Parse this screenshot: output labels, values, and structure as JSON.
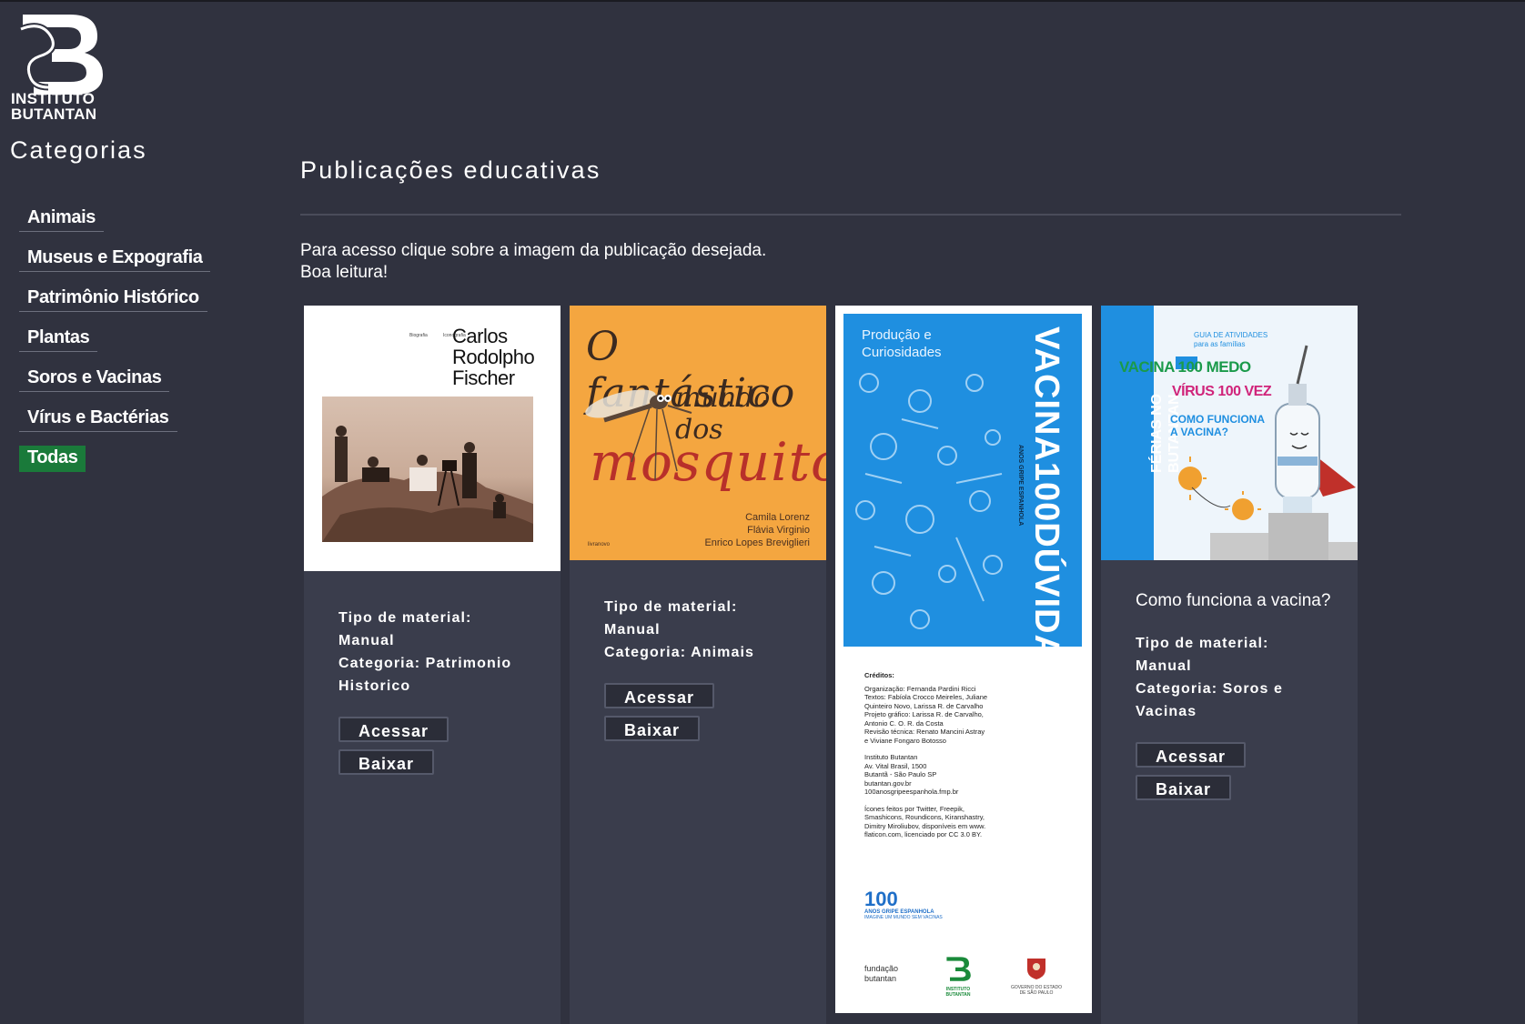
{
  "brand": {
    "line1": "INSTITUTO",
    "line2": "BUTANTAN"
  },
  "sidebar": {
    "title": "Categorias",
    "items": [
      {
        "label": "Animais",
        "active": false
      },
      {
        "label": "Museus e Expografia",
        "active": false
      },
      {
        "label": "Patrimônio Histórico",
        "active": false
      },
      {
        "label": "Plantas",
        "active": false
      },
      {
        "label": "Soros e Vacinas",
        "active": false
      },
      {
        "label": "Vírus e Bactérias",
        "active": false
      },
      {
        "label": "Todas",
        "active": true
      }
    ]
  },
  "main": {
    "title": "Publicações educativas",
    "intro_line1": "Para acesso clique sobre a imagem da publicação desejada.",
    "intro_line2": "Boa leitura!"
  },
  "cards": [
    {
      "cover": {
        "title_l1": "Carlos",
        "title_l2": "Rodolpho",
        "title_l3": "Fischer",
        "tiny_a": "Biografia",
        "tiny_b": "Iconografia"
      },
      "title": "",
      "type_label": "Tipo de material:",
      "type_value": "Manual",
      "category_line1": "Categoria: Patrimonio",
      "category_line2": "Historico",
      "access": "Acessar",
      "download": "Baixar"
    },
    {
      "cover": {
        "title_l1": "O fantástico",
        "title_l2": "mundo dos",
        "title_l3": "mosquitos",
        "author1": "Camila Lorenz",
        "author2": "Flávia Virginio",
        "author3": "Enrico Lopes Breviglieri",
        "publisher": "livranovo"
      },
      "title": "",
      "type_label": "Tipo de material:",
      "type_value": "Manual",
      "category_line1": "Categoria: Animais",
      "category_line2": "",
      "access": "Acessar",
      "download": "Baixar"
    },
    {
      "cover": {
        "sub1": "Produção e",
        "sub2": "Curiosidades",
        "spine_a": "VACINA",
        "spine_num": "100",
        "spine_b": "DÚVIDAS",
        "spine_small": "ANOS GRIPE ESPANHOLA",
        "credits_head": "Créditos:",
        "credits": [
          "Organização: Fernanda Pardini Ricci",
          "Textos: Fabíola Crocco Meireles, Juliane",
          "Quinteiro Novo, Larissa R. de Carvalho",
          "Projeto gráfico: Larissa R. de Carvalho,",
          "Antonio C. O. R. da Costa",
          "Revisão técnica: Renato Mancini Astray",
          "e Viviane Fongaro Botosso",
          "",
          "Instituto Butantan",
          "Av. Vital Brasil, 1500",
          "Butantã - São Paulo SP",
          "butantan.gov.br",
          "100anosgripeespanhola.fmp.br",
          "",
          "Ícones feitos por Twitter, Freepik,",
          "Smashicons, Roundicons, Kiranshastry,",
          "Dimitry Miroliubov, disponíveis em www.",
          "flaticon.com, licenciado por CC 3.0 BY."
        ],
        "logo100": "100",
        "logo100_sub": "ANOS GRIPE ESPANHOLA",
        "logo100_tag": "IMAGINE UM MUNDO SEM VACINAS",
        "fundacao1": "fundação",
        "fundacao2": "butantan",
        "butantan_small1": "INSTITUTO",
        "butantan_small2": "BUTANTAN",
        "gov1": "GOVERNO DO ESTADO",
        "gov2": "DE SÃO PAULO"
      }
    },
    {
      "cover": {
        "guide1": "GUIA DE ATIVIDADES",
        "guide2": "para as famílias",
        "headline1": "VACINA 100 MEDO",
        "headline2": "VÍRUS 100 VEZ",
        "question1": "COMO FUNCIONA",
        "question2": "A VACINA?",
        "vertical1": "FÉRIAS NO",
        "vertical2": "BUTANTAN"
      },
      "title": "Como funciona a vacina?",
      "type_label": "Tipo de material:",
      "type_value": "Manual",
      "category_line1": "Categoria: Soros e",
      "category_line2": "Vacinas",
      "access": "Acessar",
      "download": "Baixar"
    }
  ],
  "colors": {
    "background": "#30323f",
    "card": "#3a3d4c",
    "active": "#1a7a3a",
    "green_logo": "#1a8a3a",
    "cover_blue": "#1f8fe0",
    "cover_orange": "#f4a640"
  }
}
